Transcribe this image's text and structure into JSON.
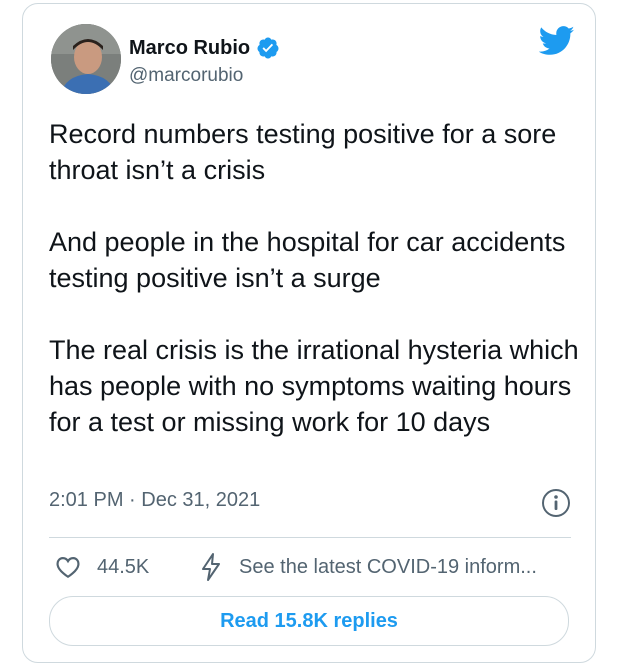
{
  "tweet": {
    "author_name": "Marco Rubio",
    "author_handle": "@marcorubio",
    "text": "Record numbers testing positive for a sore throat isn’t a crisis\n\nAnd people in the hospital for car accidents testing positive isn’t a surge\n\nThe real crisis is the irrational hysteria which has people with no symptoms waiting hours for a test or missing work for 10 days",
    "time": "2:01 PM",
    "separator": "·",
    "date": "Dec 31, 2021"
  },
  "actions": {
    "like_count": "44.5K",
    "covid_info": "See the latest COVID-19 inform..."
  },
  "replies_button": "Read 15.8K replies",
  "icons": {
    "verified": "verified-badge-icon",
    "brand": "twitter-bird-icon",
    "info": "info-icon",
    "like": "heart-icon",
    "covid": "lightning-bolt-icon"
  },
  "colors": {
    "accent": "#1d9bf0",
    "secondary_text": "#536471",
    "border": "#cfd9de"
  }
}
